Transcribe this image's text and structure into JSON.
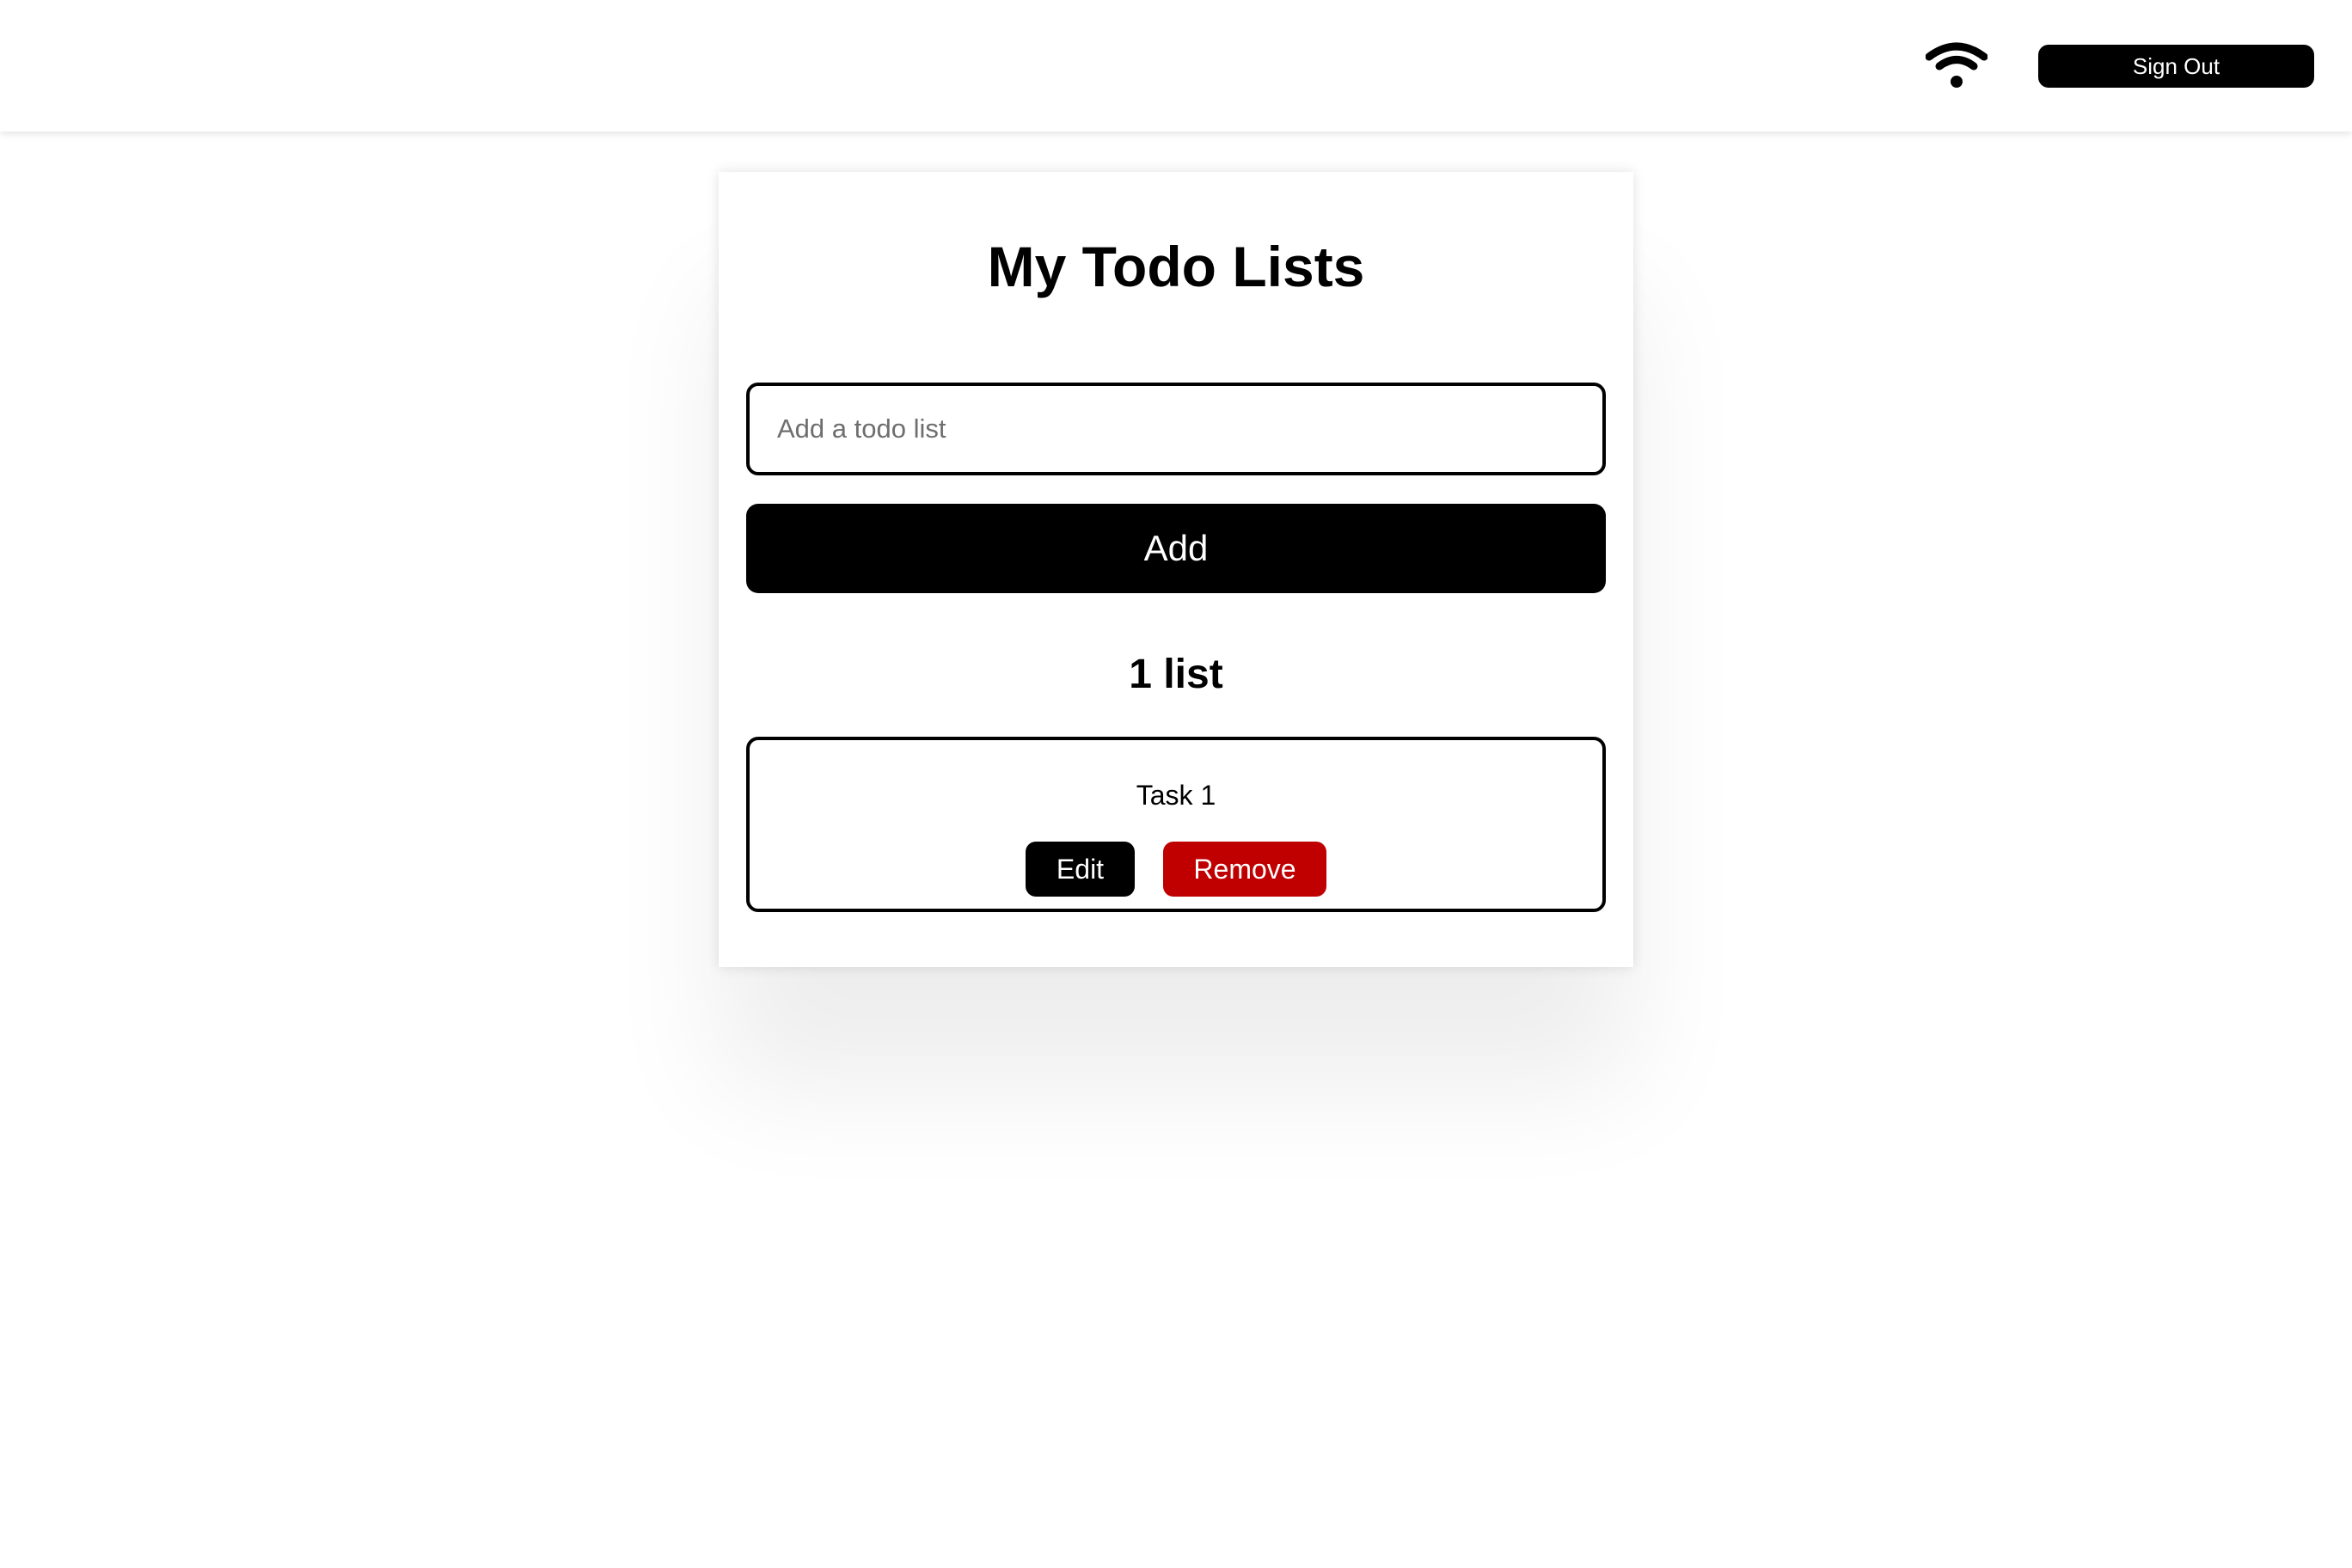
{
  "header": {
    "wifi_icon": "wifi-icon",
    "sign_out_label": "Sign Out"
  },
  "main": {
    "title": "My Todo Lists",
    "input": {
      "value": "",
      "placeholder": "Add a todo list"
    },
    "add_label": "Add",
    "count_label": "1 list",
    "lists": [
      {
        "title": "Task 1",
        "edit_label": "Edit",
        "remove_label": "Remove"
      }
    ]
  },
  "colors": {
    "primary": "#000000",
    "danger": "#c00000",
    "background": "#ffffff"
  }
}
